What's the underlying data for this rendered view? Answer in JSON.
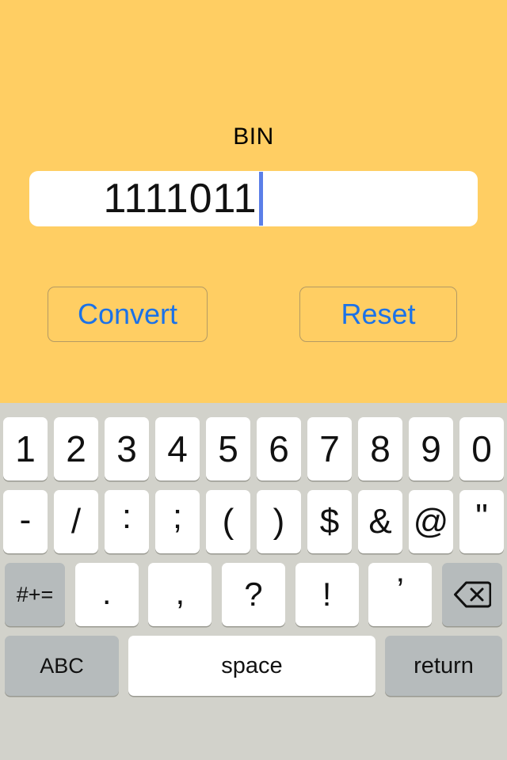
{
  "app": {
    "background_color": "#ffce63",
    "label": "BIN",
    "field": {
      "value": "1111011",
      "caret_color": "#5b7fe8",
      "background_color": "#ffffff"
    },
    "buttons": {
      "convert_label": "Convert",
      "reset_label": "Reset",
      "text_color": "#1b72e8",
      "border_color": "#b49a63"
    }
  },
  "keyboard": {
    "background_color": "#d2d2cb",
    "key_color": "#ffffff",
    "modifier_key_color": "#b6bbbc",
    "row_numbers": [
      "1",
      "2",
      "3",
      "4",
      "5",
      "6",
      "7",
      "8",
      "9",
      "0"
    ],
    "row_symbols": [
      "-",
      "/",
      ":",
      ";",
      "(",
      ")",
      "$",
      "&",
      "@",
      "\""
    ],
    "row_punctuation": {
      "shift_label": "#+=",
      "keys": [
        ".",
        ",",
        "?",
        "!",
        "’"
      ],
      "backspace_icon": "backspace-delete-icon"
    },
    "row_bottom": {
      "abc_label": "ABC",
      "space_label": "space",
      "return_label": "return"
    }
  }
}
